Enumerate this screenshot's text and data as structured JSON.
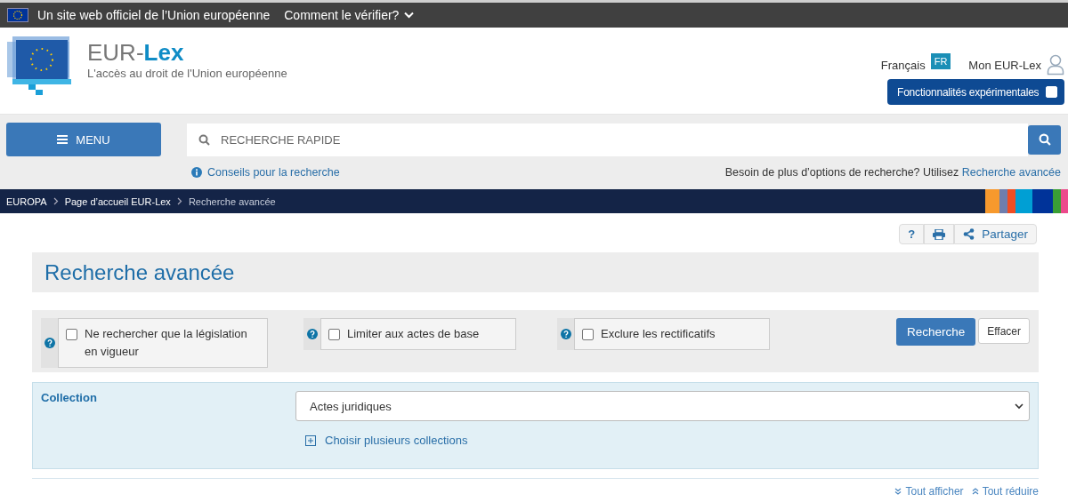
{
  "eu_banner": {
    "text": "Un site web officiel de l’Union européenne",
    "link": "Comment le vérifier?"
  },
  "header": {
    "logo_title": "EUR-**Lex**",
    "tagline": "L'accès au droit de l'Union européenne",
    "language": "Français",
    "language_code": "FR",
    "account": "Mon EUR-Lex",
    "experimental": {
      "label": "Fonctionnalités expérimentales",
      "checked": false
    }
  },
  "search_bar": {
    "menu": "MENU",
    "placeholder": "RECHERCHE RAPIDE",
    "tips": "Conseils pour la recherche",
    "advanced_prompt": "Besoin de plus d’options de recherche? Utilisez",
    "advanced_link": "Recherche avancée"
  },
  "breadcrumb": [
    {
      "label": "EUROPA",
      "current": false
    },
    {
      "label": "Page d’accueil EUR-Lex",
      "current": false
    },
    {
      "label": "Recherche avancée",
      "current": true
    }
  ],
  "tools": {
    "help": "?",
    "share": "Partager"
  },
  "page_title": "Recherche avancée",
  "options": [
    {
      "label": "Ne rechercher que la législation en vigueur",
      "checked": false
    },
    {
      "label": "Limiter aux actes de base",
      "checked": false
    },
    {
      "label": "Exclure les rectificatifs",
      "checked": false
    }
  ],
  "buttons": {
    "search": "Recherche",
    "clear": "Effacer"
  },
  "collection": {
    "label": "Collection",
    "value": "Actes juridiques",
    "link": "Choisir plusieurs collections"
  },
  "footer_links": [
    {
      "kind": "expand",
      "label": "Tout afficher"
    },
    {
      "kind": "collapse",
      "label": "Tout réduire"
    }
  ]
}
